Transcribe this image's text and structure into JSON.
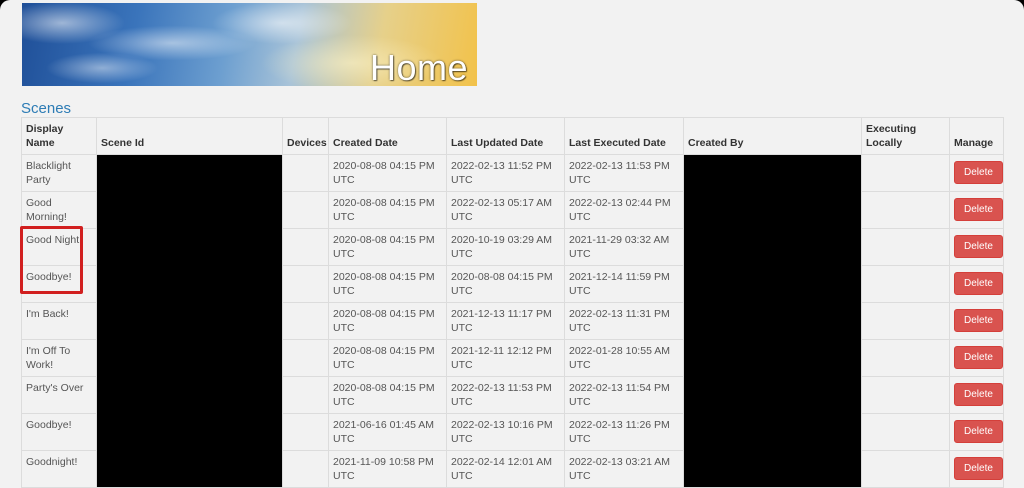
{
  "banner": {
    "title": "Home"
  },
  "section": {
    "title": "Scenes"
  },
  "table": {
    "headers": {
      "display_name": "Display Name",
      "scene_id": "Scene Id",
      "devices": "Devices",
      "created_date": "Created Date",
      "last_updated": "Last Updated Date",
      "last_executed": "Last Executed Date",
      "created_by": "Created By",
      "executing_locally": "Executing Locally",
      "manage": "Manage"
    },
    "delete_label": "Delete",
    "rows": [
      {
        "name": "Blacklight Party",
        "created": "2020-08-08 04:15 PM UTC",
        "updated": "2022-02-13 11:52 PM UTC",
        "executed": "2022-02-13 11:53 PM UTC"
      },
      {
        "name": "Good Morning!",
        "created": "2020-08-08 04:15 PM UTC",
        "updated": "2022-02-13 05:17 AM UTC",
        "executed": "2022-02-13 02:44 PM UTC"
      },
      {
        "name": "Good Night!",
        "created": "2020-08-08 04:15 PM UTC",
        "updated": "2020-10-19 03:29 AM UTC",
        "executed": "2021-11-29 03:32 AM UTC"
      },
      {
        "name": "Goodbye!",
        "created": "2020-08-08 04:15 PM UTC",
        "updated": "2020-08-08 04:15 PM UTC",
        "executed": "2021-12-14 11:59 PM UTC"
      },
      {
        "name": "I'm Back!",
        "created": "2020-08-08 04:15 PM UTC",
        "updated": "2021-12-13 11:17 PM UTC",
        "executed": "2022-02-13 11:31 PM UTC"
      },
      {
        "name": "I'm Off To Work!",
        "created": "2020-08-08 04:15 PM UTC",
        "updated": "2021-12-11 12:12 PM UTC",
        "executed": "2022-01-28 10:55 AM UTC"
      },
      {
        "name": "Party's Over",
        "created": "2020-08-08 04:15 PM UTC",
        "updated": "2022-02-13 11:53 PM UTC",
        "executed": "2022-02-13 11:54 PM UTC"
      },
      {
        "name": "Goodbye!",
        "created": "2021-06-16 01:45 AM UTC",
        "updated": "2022-02-13 10:16 PM UTC",
        "executed": "2022-02-13 11:26 PM UTC"
      },
      {
        "name": "Goodnight!",
        "created": "2021-11-09 10:58 PM UTC",
        "updated": "2022-02-14 12:01 AM UTC",
        "executed": "2022-02-13 03:21 AM UTC"
      }
    ]
  },
  "colors": {
    "section_title": "#2d7cb5",
    "delete_button": "#d9534f",
    "highlight": "#d11f1f",
    "redaction": "#000000"
  }
}
